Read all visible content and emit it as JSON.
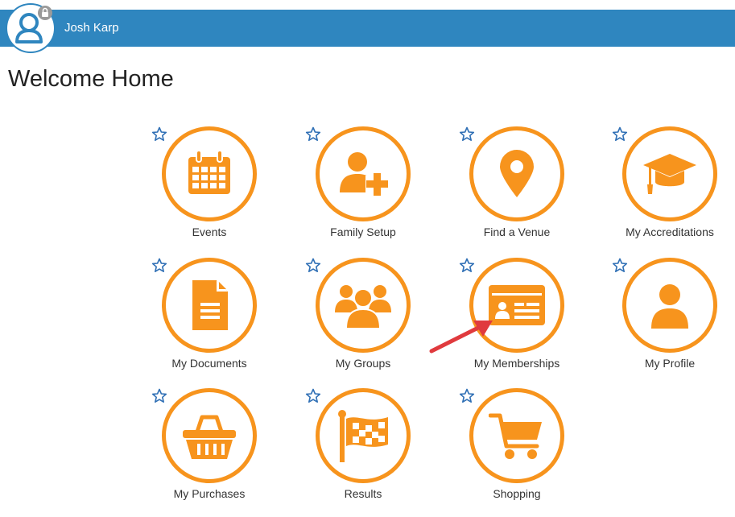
{
  "header": {
    "user_name": "Josh Karp",
    "bar_color": "#2f86bf",
    "avatar_icon": "user-avatar-icon",
    "lock_badge_icon": "lock-icon"
  },
  "page": {
    "title": "Welcome Home"
  },
  "accent_color": "#f7941d",
  "tiles": [
    {
      "label": "Events",
      "icon": "calendar-icon"
    },
    {
      "label": "Family Setup",
      "icon": "add-user-icon"
    },
    {
      "label": "Find a Venue",
      "icon": "map-pin-icon"
    },
    {
      "label": "My Accreditations",
      "icon": "graduation-cap-icon"
    },
    {
      "label": "My Documents",
      "icon": "document-icon"
    },
    {
      "label": "My Groups",
      "icon": "group-icon"
    },
    {
      "label": "My Memberships",
      "icon": "membership-card-icon"
    },
    {
      "label": "My Profile",
      "icon": "profile-icon"
    },
    {
      "label": "My Purchases",
      "icon": "basket-icon"
    },
    {
      "label": "Results",
      "icon": "checkered-flag-icon"
    },
    {
      "label": "Shopping",
      "icon": "shopping-cart-icon"
    }
  ],
  "favorite_icon": "star-outline-icon",
  "annotation": {
    "icon": "red-arrow-icon",
    "color": "#e03a3e"
  }
}
